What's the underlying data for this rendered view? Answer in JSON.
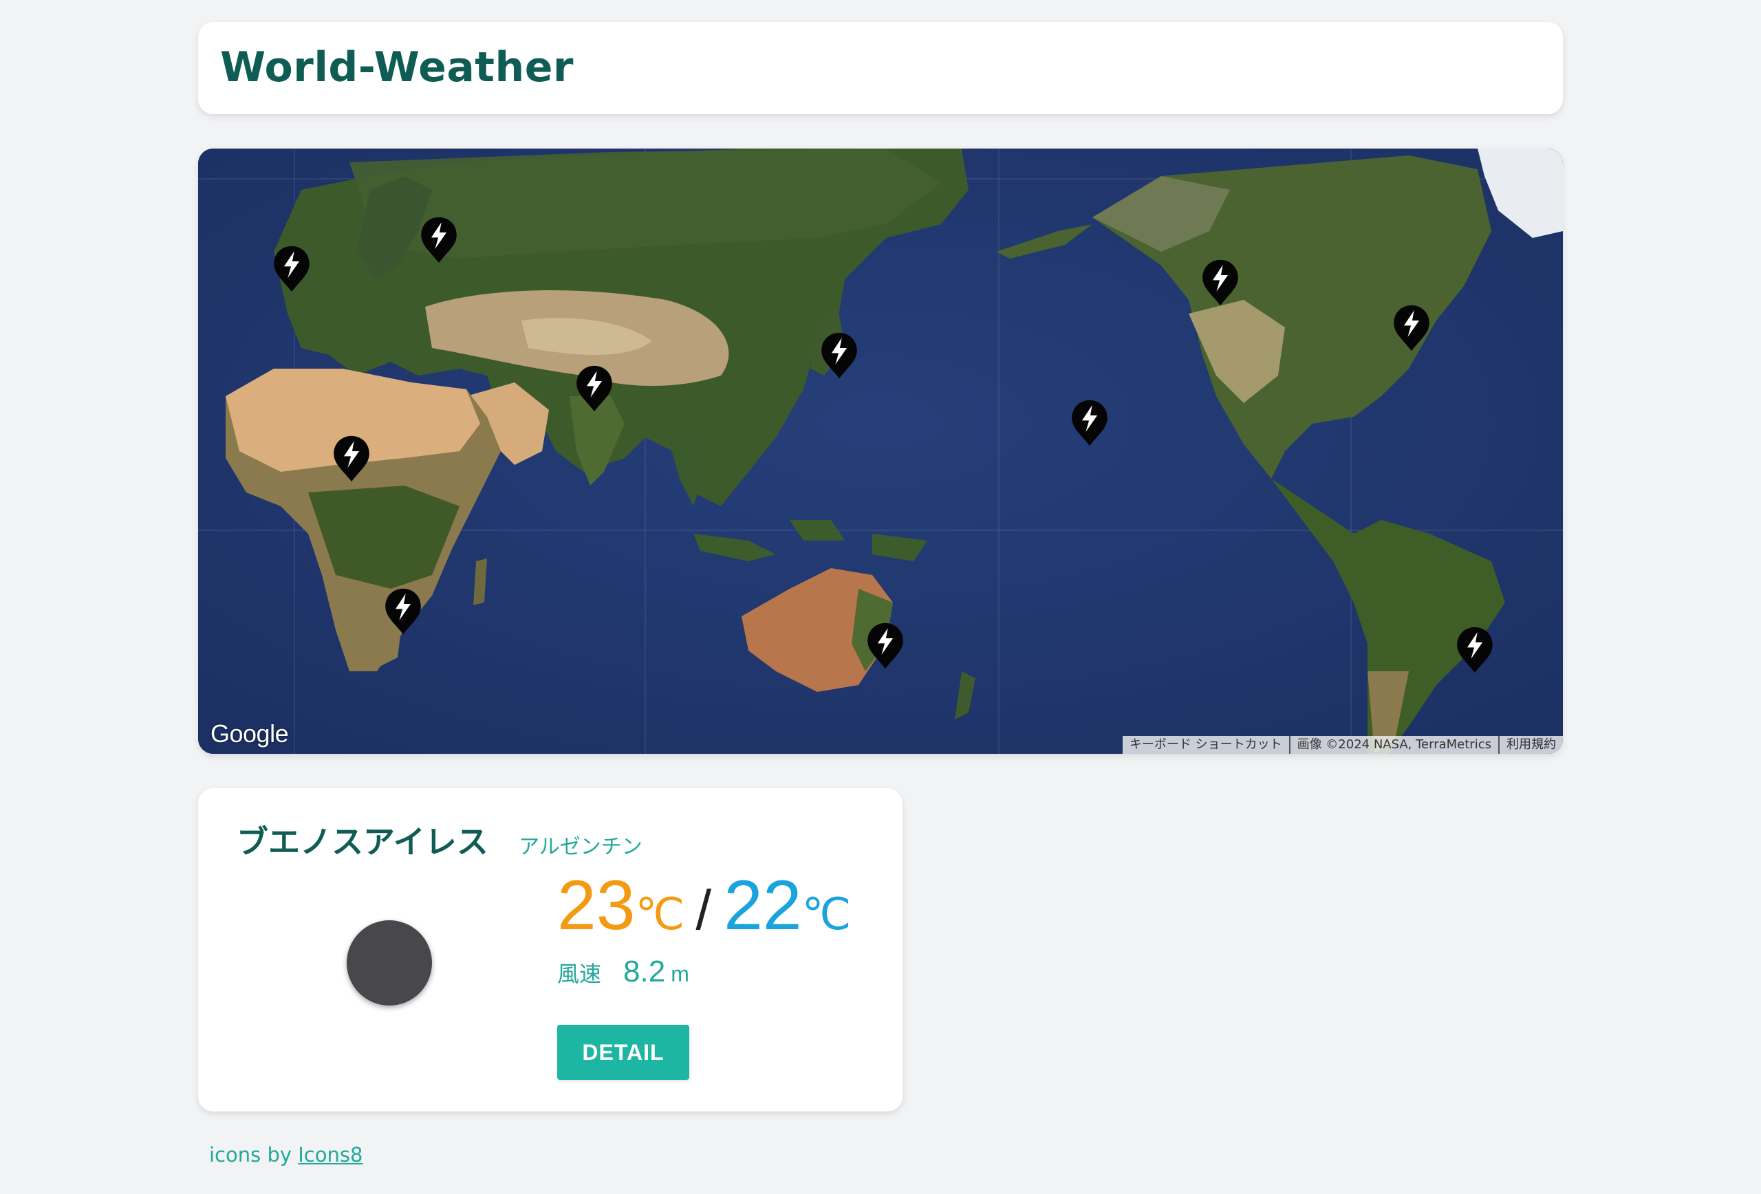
{
  "header": {
    "title": "World-Weather"
  },
  "map": {
    "google_label": "Google",
    "attribution": {
      "shortcuts": "キーボード ショートカット",
      "imagery": "画像 ©2024 NASA, TerraMetrics",
      "terms": "利用規約"
    },
    "marker_icon": "lightning-bolt-icon",
    "markers": [
      {
        "name": "marker-1"
      },
      {
        "name": "marker-2"
      },
      {
        "name": "marker-3"
      },
      {
        "name": "marker-4"
      },
      {
        "name": "marker-5"
      },
      {
        "name": "marker-6"
      },
      {
        "name": "marker-7"
      },
      {
        "name": "marker-8"
      },
      {
        "name": "marker-9"
      },
      {
        "name": "marker-10"
      },
      {
        "name": "marker-11"
      },
      {
        "name": "marker-12"
      }
    ]
  },
  "weather": {
    "city": "ブエノスアイレス",
    "country": "アルゼンチン",
    "icon": "weather-icon",
    "temp_max": "23",
    "temp_min": "22",
    "temp_unit": "℃",
    "temp_separator": "/",
    "wind_label": "風速",
    "wind_value": "8.2",
    "wind_unit": "m",
    "detail_button": "DETAIL",
    "colors": {
      "max": "#f49a12",
      "min": "#1ba3de",
      "accent": "#1db6a2",
      "title": "#0f5c55"
    }
  },
  "footer": {
    "prefix": "icons by ",
    "link_label": "Icons8"
  }
}
